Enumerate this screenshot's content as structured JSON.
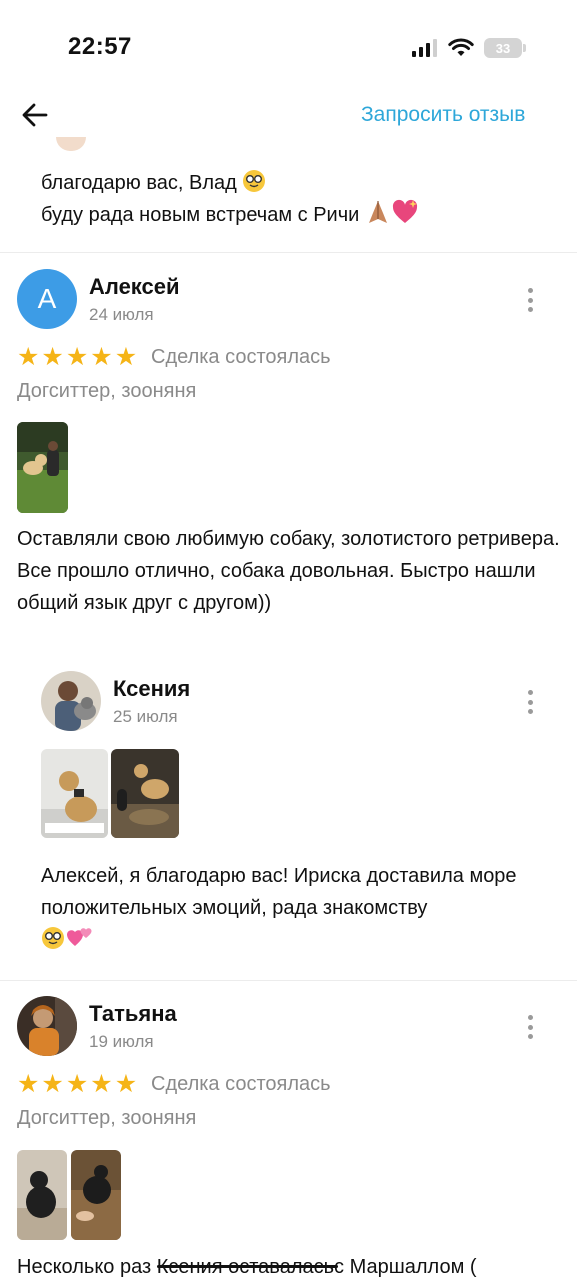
{
  "status_bar": {
    "time": "22:57",
    "battery": "33"
  },
  "header": {
    "request_review_label": "Запросить отзыв"
  },
  "top_reply": {
    "line1": "благодарю вас, Влад",
    "line2": "буду рада новым встречам с Ричи"
  },
  "review1": {
    "avatar_letter": "А",
    "author": "Алексей",
    "date": "24 июля",
    "deal_status": "Сделка состоялась",
    "service": "Догситтер, зооняня",
    "text": "Оставляли свою любимую собаку, золотистого ретривера. Все прошло отлично, собака довольная. Быстро нашли общий язык друг с другом))",
    "reply": {
      "author": "Ксения",
      "date": "25 июля",
      "text": "Алексей, я благодарю вас! Ириска доставила море положительных эмоций, рада знакомству"
    }
  },
  "review2": {
    "author": "Татьяна",
    "date": "19 июля",
    "deal_status": "Сделка состоялась",
    "service": "Догситтер, зооняня",
    "text_start": "Несколько раз",
    "text_struck": "Ксения оставалась",
    "text_end": "с Маршаллом ("
  },
  "colors": {
    "accent": "#2ea7d9",
    "star": "#f5b417",
    "avatar_blue": "#3d9ce6"
  }
}
